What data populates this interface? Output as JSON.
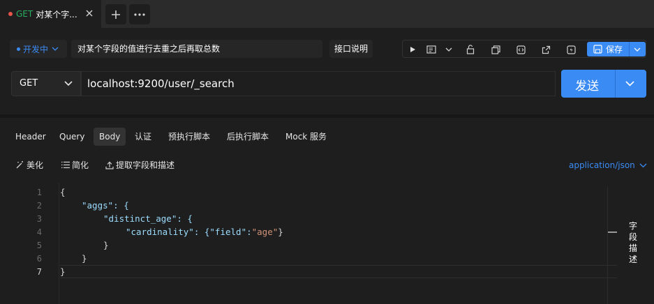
{
  "tab": {
    "method": "GET",
    "name": "对某个字...",
    "method_color": "#27ae60",
    "unsaved_dot_color": "#e5534b"
  },
  "tabbar": {
    "add_icon": "plus-icon",
    "more_icon": "ellipsis-icon"
  },
  "request": {
    "env_label": "开发中",
    "title": "对某个字段的值进行去重之后再取总数",
    "doc_button": "接口说明",
    "save_label": "保存",
    "method": "GET",
    "url": "localhost:9200/user/_search",
    "send_label": "发送"
  },
  "body_tabs": [
    "Header",
    "Query",
    "Body",
    "认证",
    "预执行脚本",
    "后执行脚本",
    "Mock 服务"
  ],
  "active_body_tab": "Body",
  "body_tools": {
    "beautify": "美化",
    "simplify": "简化",
    "extract": "提取字段和描述"
  },
  "content_type": "application/json",
  "editor": {
    "line_numbers": [
      "1",
      "2",
      "3",
      "4",
      "5",
      "6",
      "7"
    ],
    "lines": [
      "{",
      "\"aggs\": {",
      "\"distinct_age\": {",
      "\"cardinality\": {\"field\":\"age\"}",
      "}",
      "}",
      "}"
    ]
  },
  "side_panel_label": "字段描述",
  "colors": {
    "accent": "#3b8bf5",
    "background": "#1e1e1e"
  }
}
